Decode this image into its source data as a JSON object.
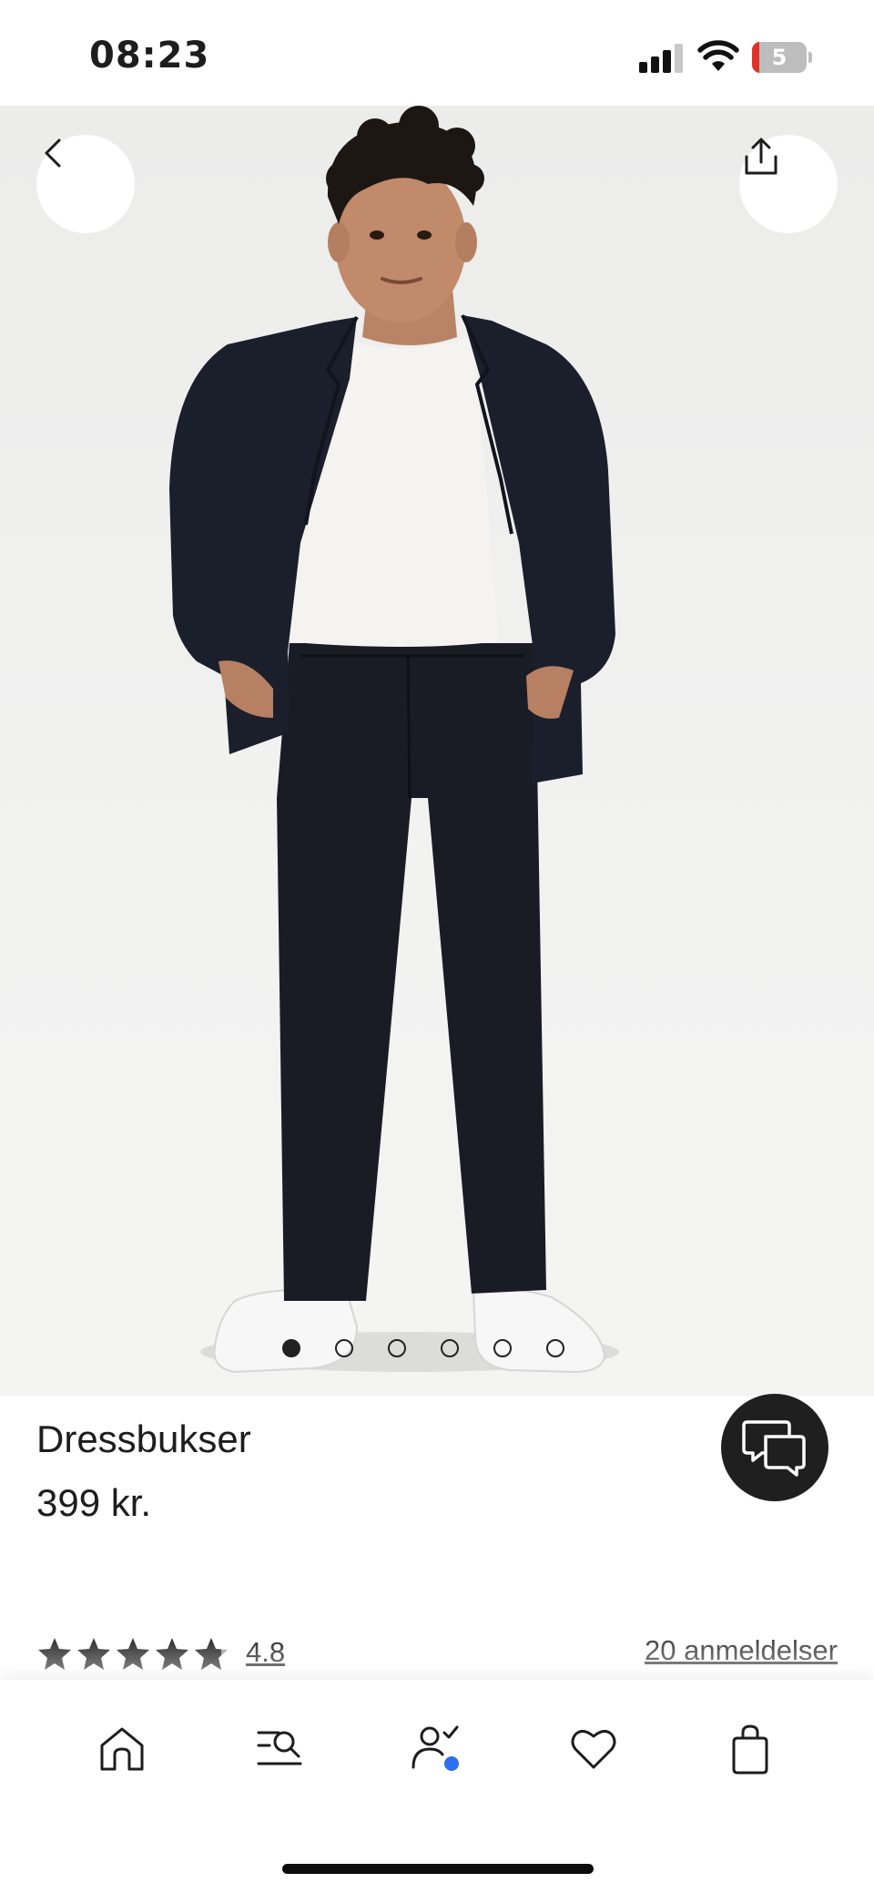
{
  "status_bar": {
    "time": "08:23",
    "battery_level": "5",
    "battery_color": "#e2302b",
    "signal_bars_active": 3
  },
  "product": {
    "name": "Dressbukser",
    "price": "399 kr.",
    "image_count": 6,
    "active_image_index": 0
  },
  "rating": {
    "value": "4.8",
    "score": 4.8,
    "max": 5,
    "reviews_label": "20 anmeldelser"
  },
  "icons": {
    "back": "chevron-left-icon",
    "share": "share-icon",
    "chat": "chat-bubbles-icon",
    "nav": [
      "home-icon",
      "search-menu-icon",
      "account-icon",
      "heart-icon",
      "shopping-bag-icon"
    ]
  },
  "colors": {
    "accent_blue": "#2b6ff0",
    "dark": "#1f1f1f"
  }
}
